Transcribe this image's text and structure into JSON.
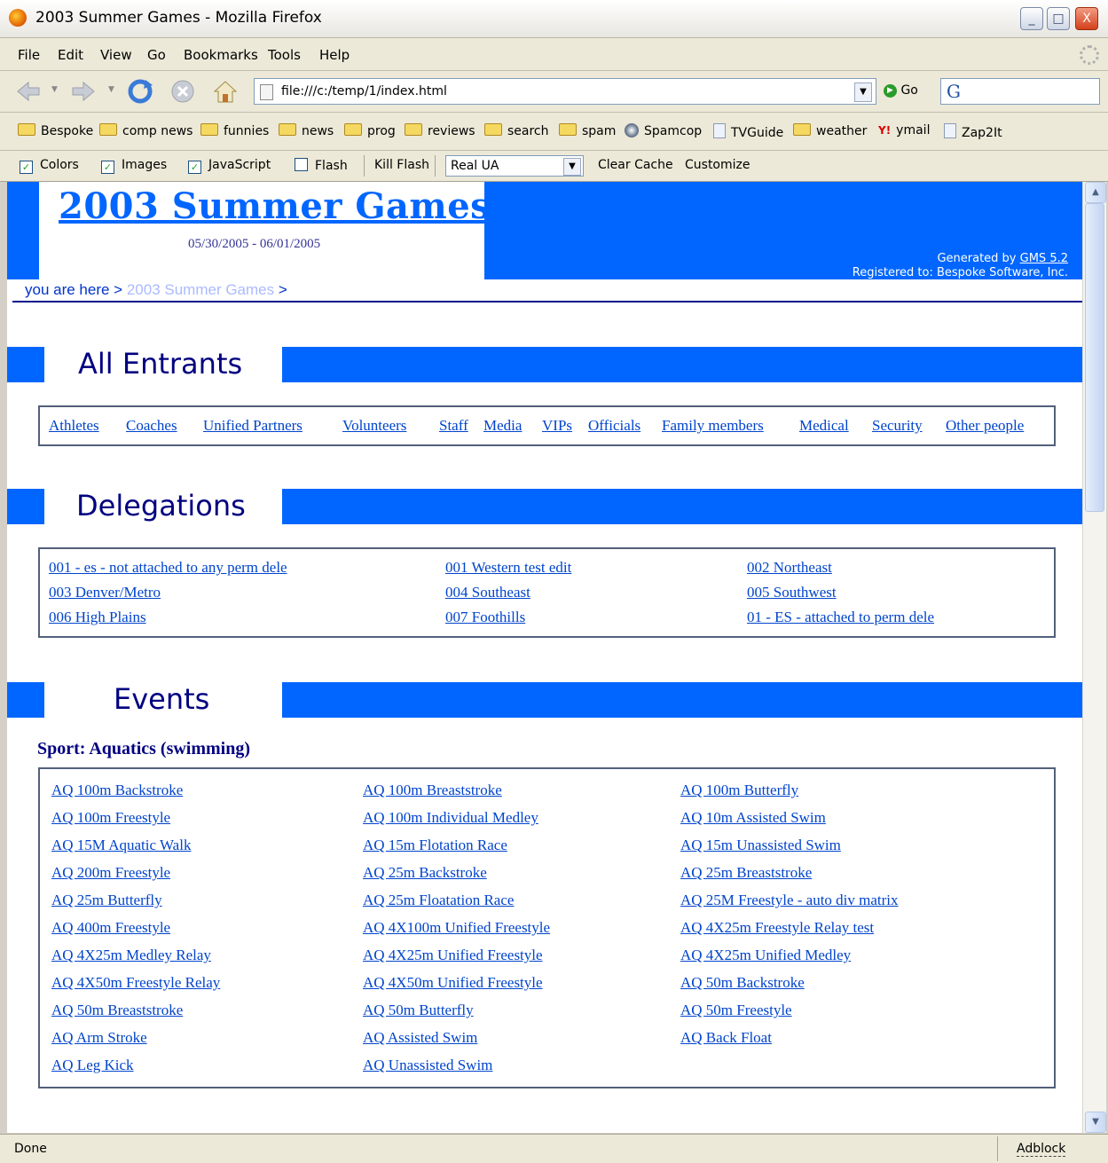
{
  "window": {
    "title": "2003 Summer Games - Mozilla Firefox",
    "min": "_",
    "max": "□",
    "close": "X"
  },
  "menu": [
    "File",
    "Edit",
    "View",
    "Go",
    "Bookmarks",
    "Tools",
    "Help"
  ],
  "nav": {
    "url": "file:///c:/temp/1/index.html",
    "go_label": "Go"
  },
  "bookmarks": [
    {
      "label": "Bespoke",
      "icon": "folder-icon"
    },
    {
      "label": "comp news",
      "icon": "folder-icon"
    },
    {
      "label": "funnies",
      "icon": "folder-icon"
    },
    {
      "label": "news",
      "icon": "folder-icon"
    },
    {
      "label": "prog",
      "icon": "folder-icon"
    },
    {
      "label": "reviews",
      "icon": "folder-icon"
    },
    {
      "label": "search",
      "icon": "folder-icon"
    },
    {
      "label": "spam",
      "icon": "folder-icon"
    },
    {
      "label": "Spamcop",
      "icon": "spamcop-icon"
    },
    {
      "label": "TVGuide",
      "icon": "page-icon"
    },
    {
      "label": "weather",
      "icon": "folder-icon"
    },
    {
      "label": "ymail",
      "icon": "yahoo-icon"
    },
    {
      "label": "Zap2It",
      "icon": "page-icon"
    }
  ],
  "webdev": {
    "colors": "Colors",
    "images": "Images",
    "javascript": "JavaScript",
    "flash": "Flash",
    "kill_flash": "Kill Flash",
    "ua_value": "Real UA",
    "clear_cache": "Clear Cache",
    "customize": "Customize",
    "colors_checked": true,
    "images_checked": true,
    "javascript_checked": true,
    "flash_checked": false
  },
  "page": {
    "title": "2003 Summer Games",
    "dates": "05/30/2005 - 06/01/2005",
    "generated_prefix": "Generated by ",
    "generated_link": "GMS 5.2",
    "registered": "Registered to: Bespoke Software, Inc.",
    "crumb_prefix": "you are here > ",
    "crumb_current": "2003 Summer Games",
    "crumb_suffix": " >"
  },
  "entrants": {
    "heading": "All Entrants",
    "links": [
      "Athletes",
      "Coaches",
      "Unified Partners",
      "Volunteers",
      "Staff",
      "Media",
      "VIPs",
      "Officials",
      "Family members",
      "Medical",
      "Security",
      "Other people"
    ]
  },
  "delegations": {
    "heading": "Delegations",
    "links": [
      "001 - es - not attached to any perm dele",
      "001 Western test edit",
      "002 Northeast",
      "003 Denver/Metro",
      "004 Southeast",
      "005 Southwest",
      "006 High Plains",
      "007 Foothills",
      "01 - ES - attached to perm dele"
    ]
  },
  "events": {
    "heading": "Events",
    "sport": "Sport: Aquatics (swimming)",
    "links": [
      "AQ 100m Backstroke",
      "AQ 100m Breaststroke",
      "AQ 100m Butterfly",
      "AQ 100m Freestyle",
      "AQ 100m Individual Medley",
      "AQ 10m Assisted Swim",
      "AQ 15M Aquatic Walk",
      "AQ 15m Flotation Race",
      "AQ 15m Unassisted Swim",
      "AQ 200m Freestyle",
      "AQ 25m Backstroke",
      "AQ 25m Breaststroke",
      "AQ 25m Butterfly",
      "AQ 25m Floatation Race",
      "AQ 25M Freestyle - auto div matrix",
      "AQ 400m Freestyle",
      "AQ 4X100m Unified Freestyle",
      "AQ 4X25m Freestyle Relay test",
      "AQ 4X25m Medley Relay",
      "AQ 4X25m Unified Freestyle",
      "AQ 4X25m Unified Medley",
      "AQ 4X50m Freestyle Relay",
      "AQ 4X50m Unified Freestyle",
      "AQ 50m Backstroke",
      "AQ 50m Breaststroke",
      "AQ 50m Butterfly",
      "AQ 50m Freestyle",
      "AQ Arm Stroke",
      "AQ Assisted Swim",
      "AQ Back Float",
      "AQ Leg Kick",
      "AQ Unassisted Swim"
    ]
  },
  "status": {
    "text": "Done",
    "adblock": "Adblock"
  },
  "colors": {
    "header_blue": "#0066ff",
    "heading_navy": "#000080",
    "link": "#0044cc"
  }
}
